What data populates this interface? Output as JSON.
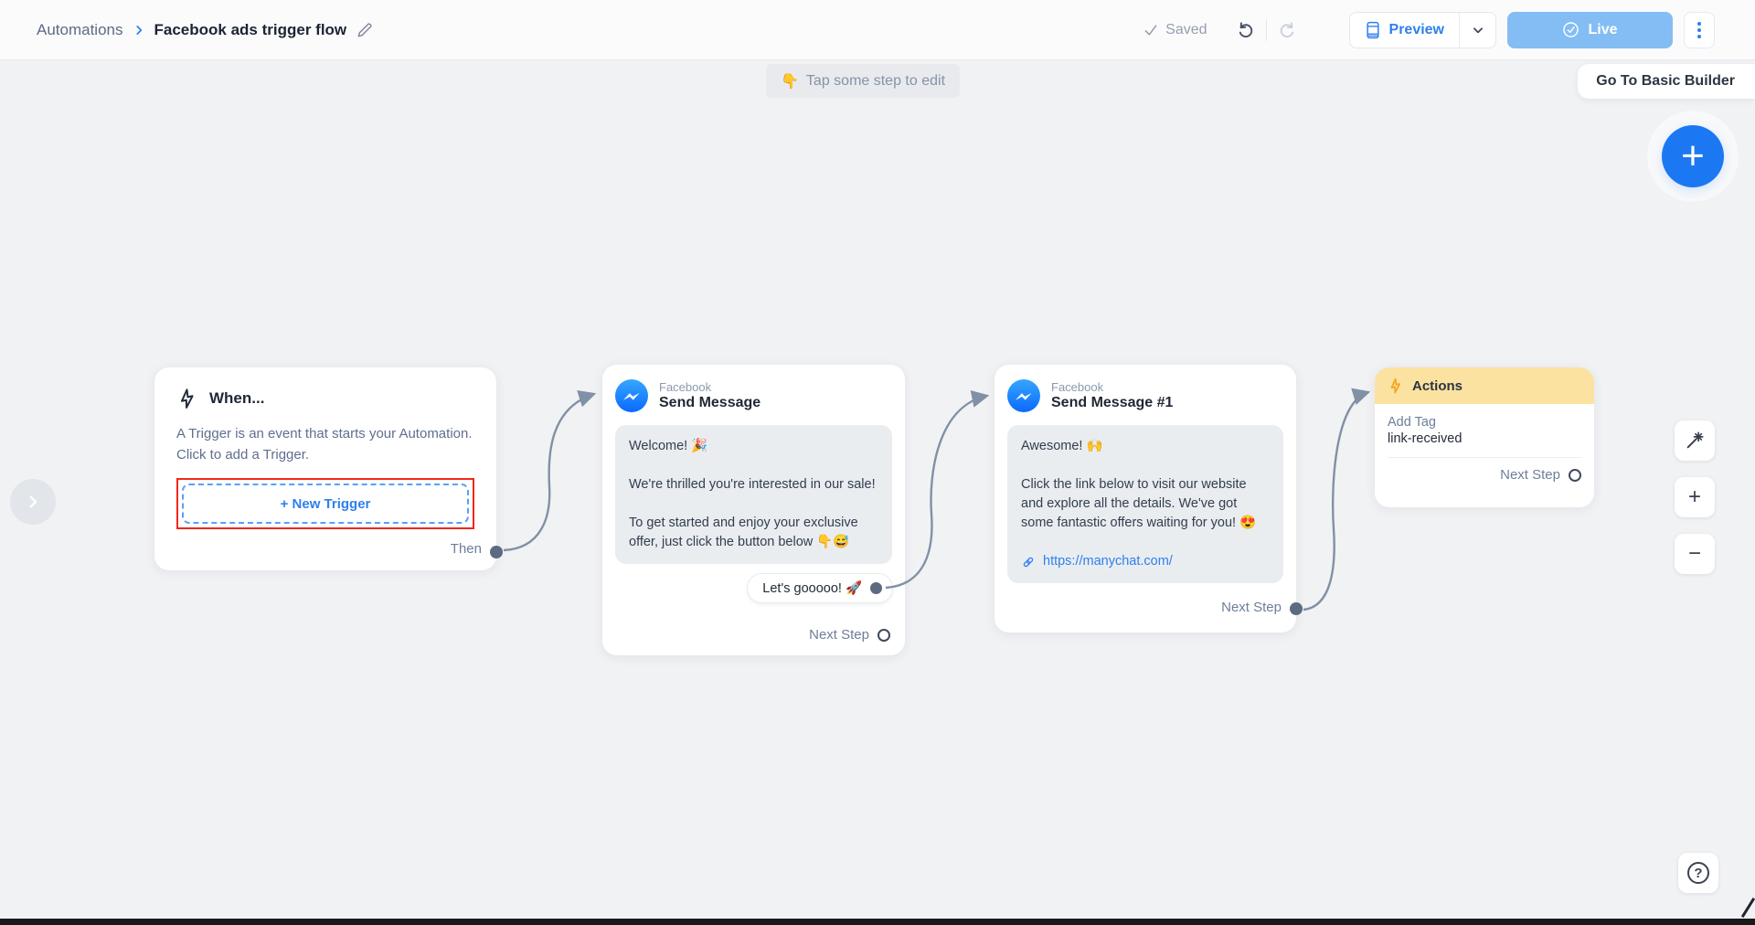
{
  "header": {
    "breadcrumb_root": "Automations",
    "title": "Facebook ads trigger flow",
    "saved_label": "Saved",
    "preview_label": "Preview",
    "live_label": "Live"
  },
  "canvas": {
    "tooltip_emoji": "👇",
    "tooltip_text": "Tap some step to edit",
    "go_to_basic_builder_label": "Go To Basic Builder",
    "fab_glyph": "+",
    "zoom_in_glyph": "+",
    "zoom_out_glyph": "−",
    "help_glyph": "?"
  },
  "nodes": {
    "trigger": {
      "title": "When...",
      "description_line1": "A Trigger is an event that starts your Automation.",
      "description_line2": "Click to add a Trigger.",
      "new_trigger_label": "+ New Trigger",
      "then_label": "Then"
    },
    "message1": {
      "channel": "Facebook",
      "title": "Send Message",
      "paragraph1": "Welcome! 🎉",
      "paragraph2": "We're thrilled you're interested in our sale!",
      "paragraph3": "To get started and enjoy your exclusive offer, just click the button below 👇😅",
      "quick_reply_label": "Let's gooooo! 🚀",
      "next_step_label": "Next Step"
    },
    "message2": {
      "channel": "Facebook",
      "title": "Send Message #1",
      "paragraph1": "Awesome! 🙌",
      "paragraph2": "Click the link below to visit our website and explore all the details. We've got some fantastic offers waiting for you! 😍",
      "link": "https://manychat.com/",
      "next_step_label": "Next Step"
    },
    "actions": {
      "title": "Actions",
      "action_type": "Add Tag",
      "action_value": "link-received",
      "next_step_label": "Next Step"
    }
  },
  "colors": {
    "accent_blue": "#2F80ED",
    "live_blue": "#84BDF4",
    "highlight_red": "#F0281C",
    "actions_yellow": "#FBE2A0",
    "connector_gray": "#8191A5",
    "canvas_bg": "#F1F2F4"
  }
}
